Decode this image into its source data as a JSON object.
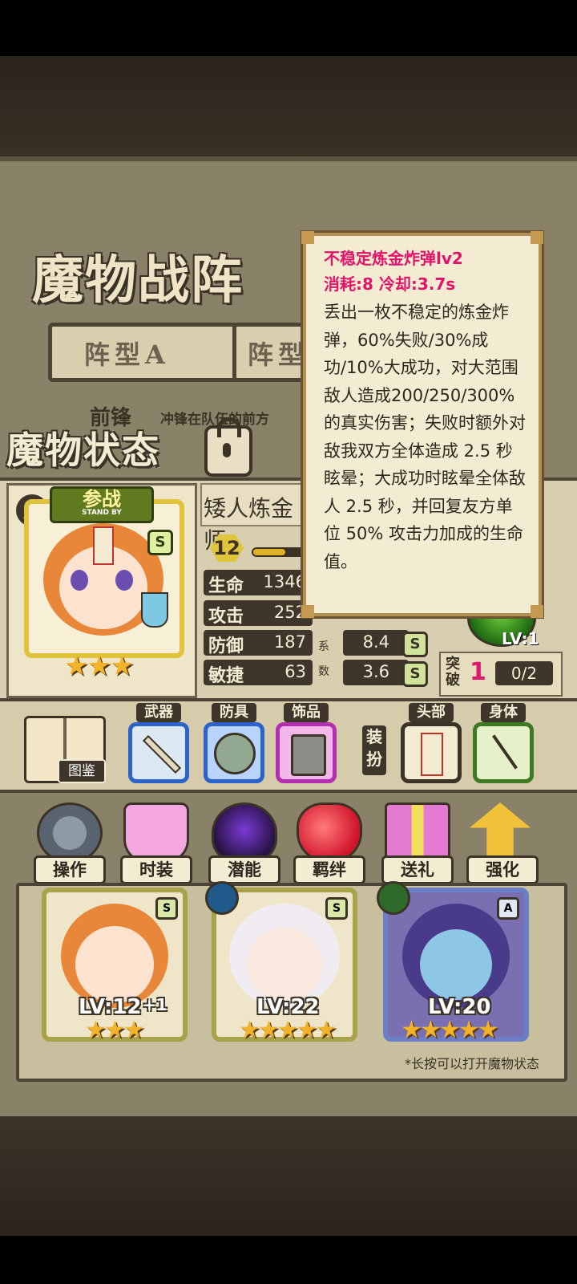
{
  "title": "魔物战阵",
  "tabs": [
    {
      "label": "阵型A"
    },
    {
      "label": "阵型"
    }
  ],
  "front_row": {
    "label": "前锋",
    "desc": "冲锋在队伍的前方"
  },
  "status_title": "魔物状态",
  "monster": {
    "name": "矮人炼金师",
    "level": "12",
    "rank": "S",
    "standby_label": "参战",
    "standby_sub": "STAND BY",
    "stars": "★★★",
    "stats": [
      {
        "label": "生命",
        "value": "1346"
      },
      {
        "label": "攻击",
        "value": "252"
      },
      {
        "label": "防御",
        "value": "187"
      },
      {
        "label": "敏捷",
        "value": "63"
      }
    ],
    "coef_labels": [
      "系",
      "数"
    ],
    "coefficients": [
      {
        "value": "8.4",
        "grade": "S"
      },
      {
        "value": "3.6",
        "grade": "S"
      }
    ],
    "skill_level": "LV:1",
    "breakthrough": {
      "label": "突破",
      "count": "1",
      "progress": "0/2"
    }
  },
  "tooltip": {
    "title": "不稳定炼金炸弹lv2",
    "cost": "消耗:8  冷却:3.7s",
    "desc": "丢出一枚不稳定的炼金炸弹，60%失败/30%成功/10%大成功，对大范围敌人造成200/250/300%的真实伤害；失败时额外对敌我双方全体造成 2.5 秒眩晕；大成功时眩晕全体敌人 2.5 秒，并回复友方单位 50% 攻击力加成的生命值。"
  },
  "equipment": {
    "book_label": "图鉴",
    "slots": [
      {
        "label": "武器"
      },
      {
        "label": "防具"
      },
      {
        "label": "饰品"
      }
    ],
    "dress_label": "装扮",
    "dress_slots": [
      {
        "label": "头部"
      },
      {
        "label": "身体"
      }
    ]
  },
  "menu": [
    {
      "label": "操作",
      "icon": "gear-icon"
    },
    {
      "label": "时装",
      "icon": "outfit-icon"
    },
    {
      "label": "潜能",
      "icon": "demon-icon"
    },
    {
      "label": "羁绊",
      "icon": "heart-icon"
    },
    {
      "label": "送礼",
      "icon": "gift-icon"
    },
    {
      "label": "强化",
      "icon": "upgrade-arrow-icon"
    }
  ],
  "roster": [
    {
      "level": "LV:12",
      "bonus": "+1",
      "stars": "★★★",
      "rank": "S"
    },
    {
      "level": "LV:22",
      "stars": "★★★★★",
      "rank": "S"
    },
    {
      "level": "LV:20",
      "stars": "★★★★★",
      "rank": "A"
    }
  ],
  "hint": "*长按可以打开魔物状态",
  "colors": {
    "tooltip_accent": "#e0146a",
    "card_border": "#a8a24a",
    "panel": "#d8cfb0"
  }
}
